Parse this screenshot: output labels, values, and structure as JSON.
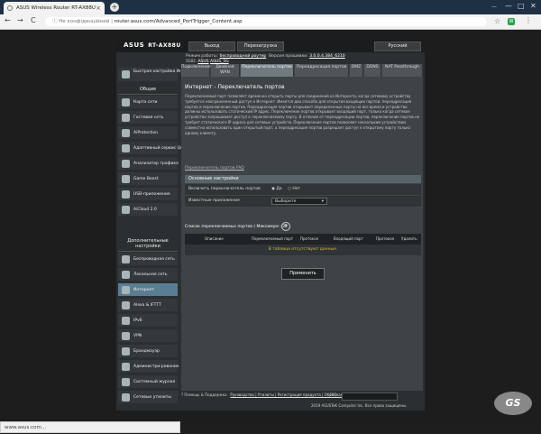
{
  "browser": {
    "tab_title": "ASUS Wireless Router RT-AX88U",
    "tab_close": "×",
    "new_tab": "+",
    "user_label": "—",
    "win_min": "—",
    "win_max": "□",
    "win_close": "✕",
    "nav_back": "←",
    "nav_forward": "→",
    "nav_reload": "C",
    "security_label": "ⓘ Не конфіденційний",
    "separator": " | ",
    "url": "router.asus.com/Advanced_PortTrigger_Content.asp",
    "bookmark_star": "☆",
    "ext_icon_text": "W",
    "menu_dots": "⋮",
    "status_url": "www.asus.com..."
  },
  "router": {
    "logo": "ASUS",
    "model": "RT-AX88U",
    "logout_label": "Выход",
    "reboot_label": "Перезагрузка",
    "language_label": "Русский",
    "status": {
      "line1_prefix": "Режим работы:",
      "mode": "беспроводной роутер",
      "fw_prefix": "Версия прошивки:",
      "fw": "3.0.0.4.384_6210",
      "ssid_prefix": "SSID:",
      "ssid1": "ASUS",
      "ssid2": "ASUS_5G"
    },
    "sidebar": {
      "quick_setup": "Быстрая настройка Интернет",
      "general_header": "Общие",
      "general_items": [
        "Карта сети",
        "Гостевая сеть",
        "AiProtection",
        "Адаптивный сервис QoS",
        "Анализатор трафика",
        "Game Boost",
        "USB-приложение",
        "AiCloud 2.0"
      ],
      "advanced_header": "Дополнительные настройки",
      "advanced_items": [
        "Беспроводная сеть",
        "Локальная сеть",
        "Интернет",
        "Alexa & IFTTT",
        "IPv6",
        "VPN",
        "Брандмауэр",
        "Администри-рование",
        "Системный журнал",
        "Сетевые утилиты"
      ]
    },
    "tabs": [
      "Подключение",
      "Двойной WAN",
      "Переключатель портов",
      "Переадресация портов",
      "DMZ",
      "DDNS",
      "NAT Passthrough"
    ],
    "page_title": "Интернет - Переключатель портов",
    "description": "Переключаемый порт позволяет временно открыть порты для соединений из Интернета, когда сетевому устройству требуется неограниченный доступ к Интернет. Имеется два способа для открытия входящих портов: переадресация портов и переключение портов. Переадресация портов открывает определенные порты на все время и устройства должны использовать статический IP адрес. Переключение портов открывает входящий порт, только когда сетевое устройство запрашивает доступ к переключаемому порту. В отличие от переадресации портов, переключение портов не требует статического IP адреса для сетевых устройств. Переключение портов позволяет нескольким устройствам совместно использовать один открытый порт, а переадресация портов разрешает доступ к открытому порту только одному клиенту.",
    "faq_link": "Переключатель портов FAQ",
    "basic_section": "Основные настройки",
    "enable_label": "Включить переключатель портов",
    "yes_label": "Да",
    "no_label": "Нет",
    "known_apps_label": "Известные приложения",
    "select_value": "Выберите",
    "list_title": "Список переключаемых портов ( Максимум : 32 )",
    "add_button": "+",
    "columns": [
      "Описание",
      "Переключаемый порт",
      "Протокол",
      "Входящий порт",
      "Протокол",
      "Удалить"
    ],
    "empty_text": "В таблице отсутствуют данные.",
    "apply_label": "Применить",
    "footer": {
      "help_label": "Помощь & Поддержка",
      "links": "Руководство | Утилиты | Регистрация продукта | Обратная связь",
      "faq_label": "FAQ",
      "copyright": "2019 ASUSTeK Computer Inc. Все права защищены."
    }
  },
  "watermark": "GS"
}
